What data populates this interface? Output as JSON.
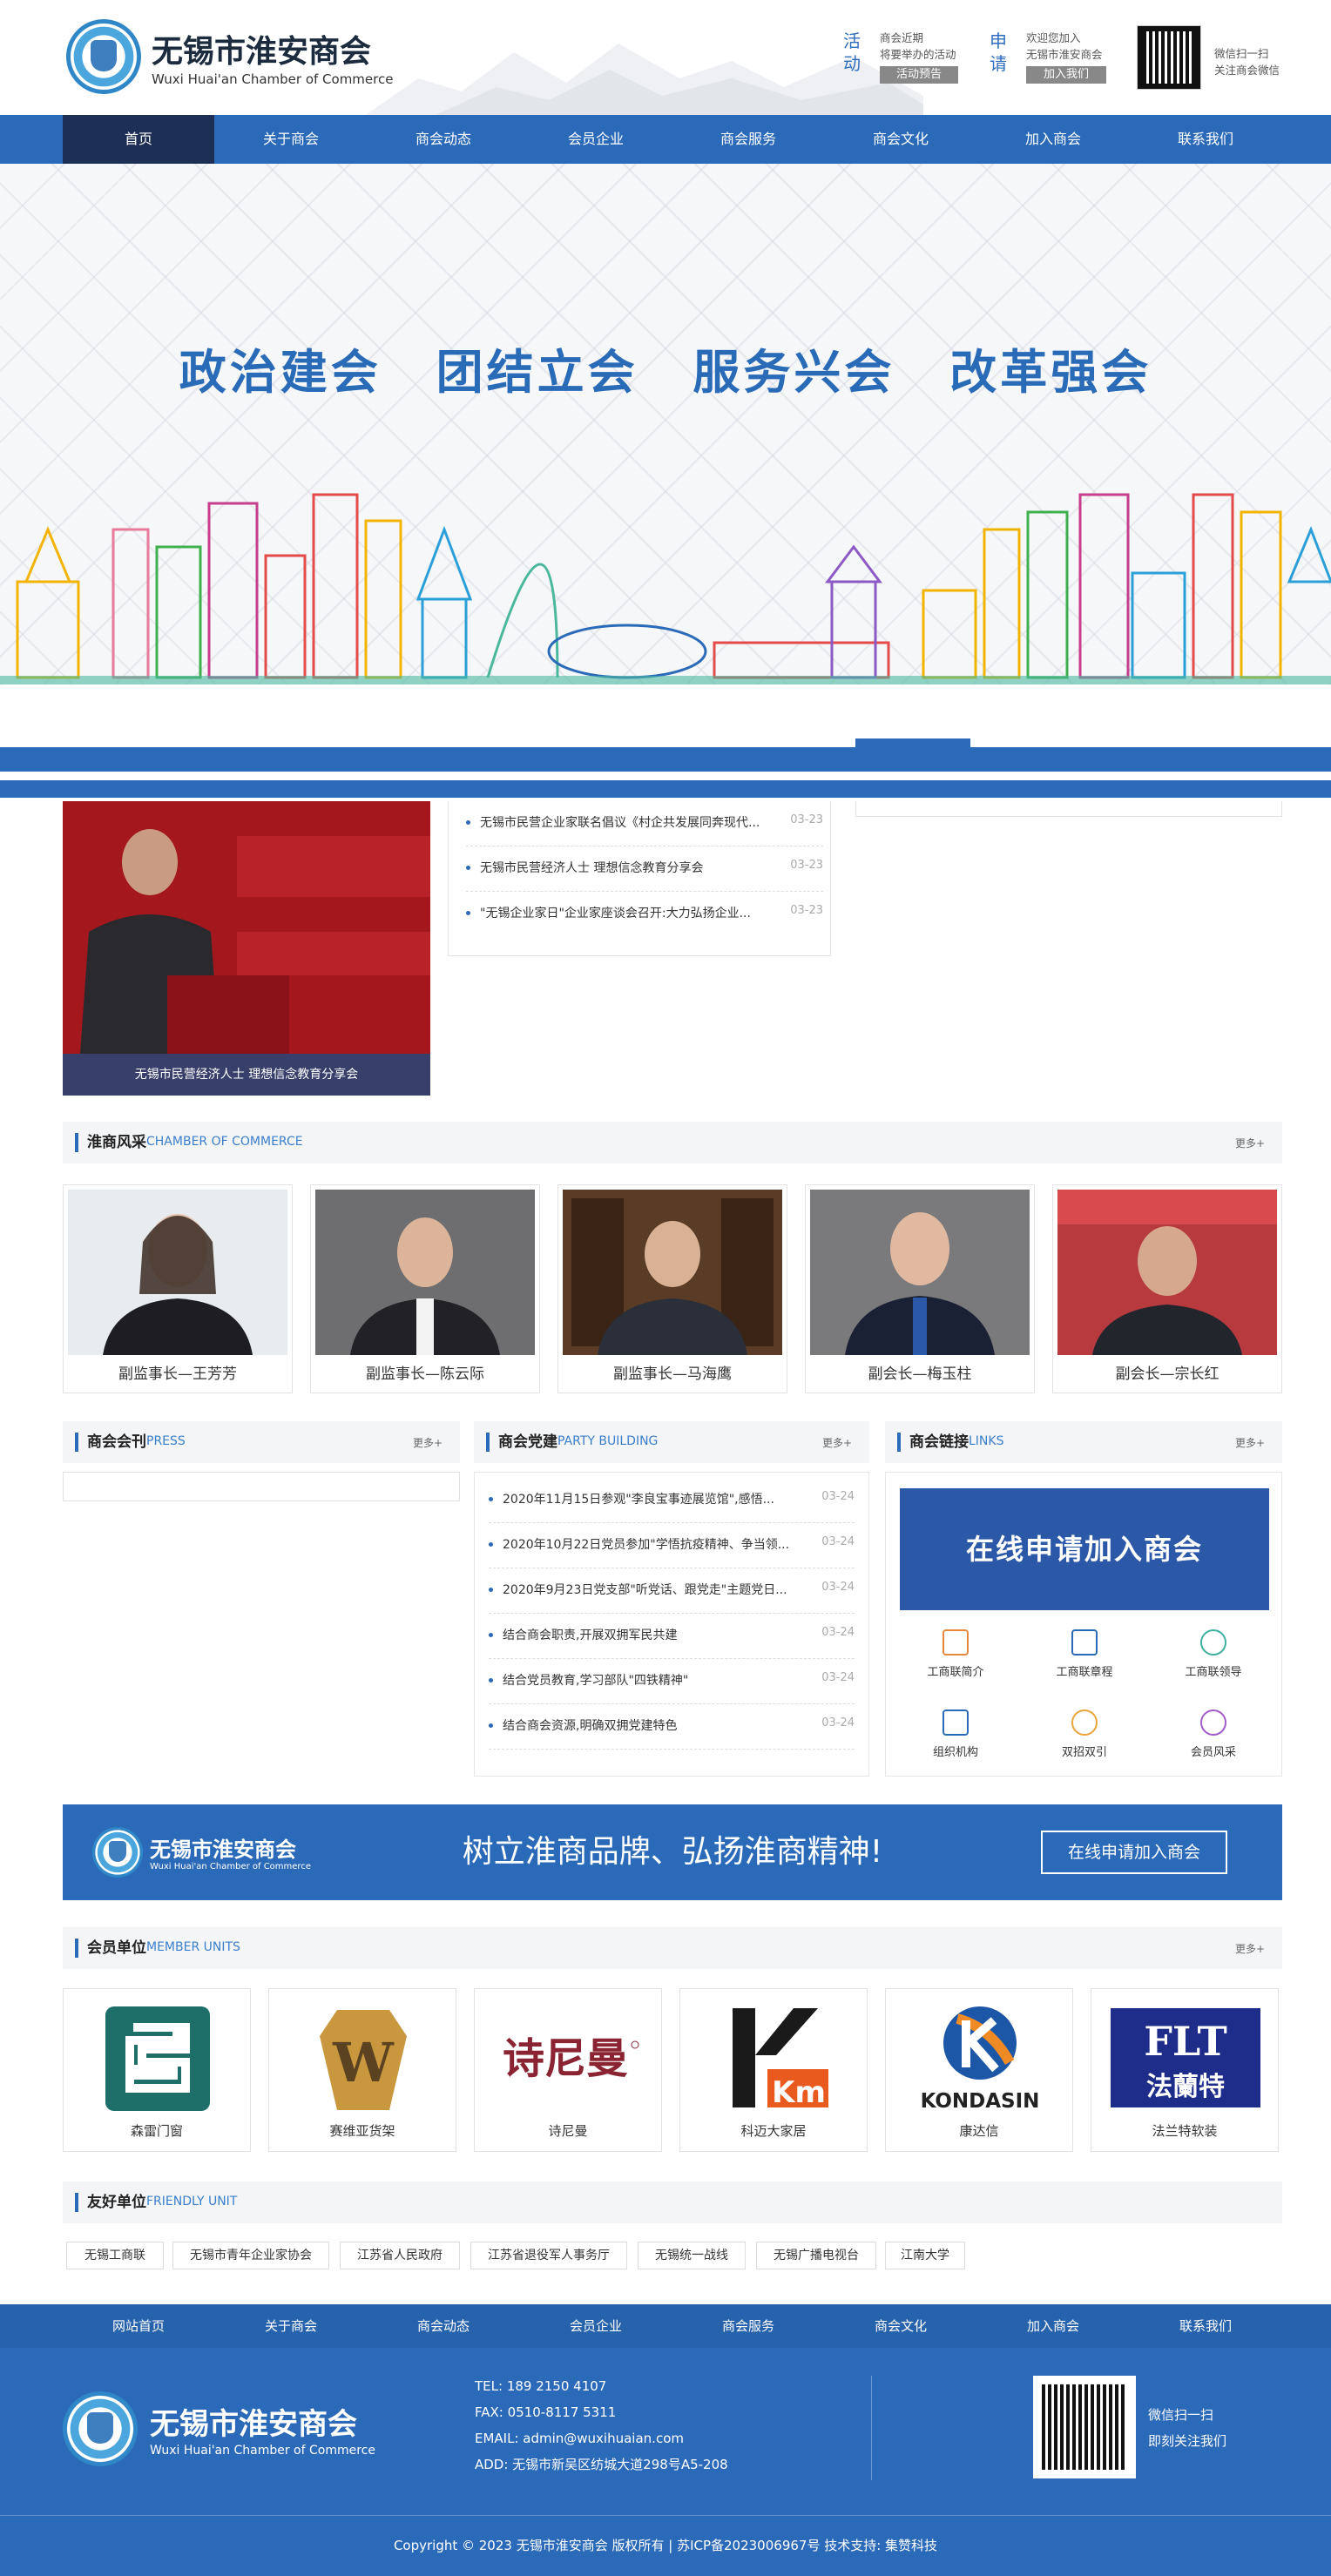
{
  "header": {
    "logo_cn": "无锡市淮安商会",
    "logo_en": "Wuxi Huai'an Chamber of Commerce",
    "activity": {
      "vertical": "活动",
      "line1": "商会近期",
      "line2": "将要举办的活动",
      "button": "活动预告"
    },
    "apply": {
      "vertical": "申请",
      "line1": "欢迎您加入",
      "line2": "无锡市淮安商会",
      "button": "加入我们"
    },
    "wechat": {
      "line1": "微信扫一扫",
      "line2": "关注商会微信"
    }
  },
  "nav": [
    "首页",
    "关于商会",
    "商会动态",
    "会员企业",
    "商会服务",
    "商会文化",
    "加入商会",
    "联系我们"
  ],
  "banner": {
    "slogan": "政治建会 团结立会 服务兴会 改革强会"
  },
  "news": {
    "photo_caption": "无锡市民营经济人士 理想信念教育分享会",
    "items": [
      {
        "title": "无锡市民营企业家联名倡议《村企共发展同奔现代...",
        "date": "03-23"
      },
      {
        "title": "无锡市民营经济人士 理想信念教育分享会",
        "date": "03-23"
      },
      {
        "title": "\"无锡企业家日\"企业家座谈会召开:大力弘扬企业...",
        "date": "03-23"
      }
    ]
  },
  "sections": {
    "style": {
      "cn": "淮商风采",
      "en": "CHAMBER OF COMMERCE",
      "more": "更多+"
    },
    "press": {
      "cn": "商会会刊",
      "en": "PRESS",
      "more": "更多+"
    },
    "party": {
      "cn": "商会党建",
      "en": "PARTY BUILDING",
      "more": "更多+"
    },
    "links": {
      "cn": "商会链接",
      "en": "LINKS",
      "more": "更多+"
    },
    "members": {
      "cn": "会员单位",
      "en": "MEMBER UNITS",
      "more": "更多+"
    },
    "friendly": {
      "cn": "友好单位",
      "en": "FRIENDLY UNIT"
    }
  },
  "people": [
    {
      "name": "副监事长—王芳芳"
    },
    {
      "name": "副监事长—陈云际"
    },
    {
      "name": "副监事长—马海鹰"
    },
    {
      "name": "副会长—梅玉柱"
    },
    {
      "name": "副会长—宗长红"
    }
  ],
  "party_news": [
    {
      "title": "2020年11月15日参观\"李良宝事迹展览馆\",感悟...",
      "date": "03-24"
    },
    {
      "title": "2020年10月22日党员参加\"学悟抗疫精神、争当领...",
      "date": "03-24"
    },
    {
      "title": "2020年9月23日党支部\"听党话、跟党走\"主题党日...",
      "date": "03-24"
    },
    {
      "title": "结合商会职责,开展双拥军民共建",
      "date": "03-24"
    },
    {
      "title": "结合党员教育,学习部队\"四铁精神\"",
      "date": "03-24"
    },
    {
      "title": "结合商会资源,明确双拥党建特色",
      "date": "03-24"
    }
  ],
  "links_box": {
    "banner": "在线申请加入商会",
    "items": [
      "工商联简介",
      "工商联章程",
      "工商联领导",
      "组织机构",
      "双招双引",
      "会员风采"
    ]
  },
  "promo": {
    "logo_cn": "无锡市淮安商会",
    "logo_en": "Wuxi Huai'an Chamber of Commerce",
    "slogan": "树立淮商品牌、弘扬淮商精神!",
    "button": "在线申请加入商会"
  },
  "members": [
    {
      "name": "森雷门窗"
    },
    {
      "name": "赛维亚货架",
      "logo_text": "W"
    },
    {
      "name": "诗尼曼",
      "logo_text": "诗尼曼"
    },
    {
      "name": "科迈大家居",
      "logo_text": "Km"
    },
    {
      "name": "康达信",
      "logo_text": "KONDASIN"
    },
    {
      "name": "法兰特软装",
      "logo_text": "FLT",
      "logo_text2": "法蘭特"
    }
  ],
  "friendly": [
    "无锡工商联",
    "无锡市青年企业家协会",
    "江苏省人民政府",
    "江苏省退役军人事务厅",
    "无锡统一战线",
    "无锡广播电视台",
    "江南大学"
  ],
  "footer": {
    "nav": [
      "网站首页",
      "关于商会",
      "商会动态",
      "会员企业",
      "商会服务",
      "商会文化",
      "加入商会",
      "联系我们"
    ],
    "logo_cn": "无锡市淮安商会",
    "logo_en": "Wuxi Huai'an Chamber of Commerce",
    "tel": "TEL:  189 2150 4107",
    "fax": "FAX:  0510-8117 5311",
    "email": "EMAIL:  admin@wuxihuaian.com",
    "addr": "ADD:  无锡市新吴区纺城大道298号A5-208",
    "wechat1": "微信扫一扫",
    "wechat2": "即刻关注我们",
    "copyright": "Copyright © 2023 无锡市淮安商会 版权所有 | 苏ICP备2023006967号   技术支持: 集赞科技"
  },
  "colors": {
    "primary": "#2b6ab8",
    "nav_active": "#1e2f55",
    "accent_en": "#3a7fcb"
  }
}
